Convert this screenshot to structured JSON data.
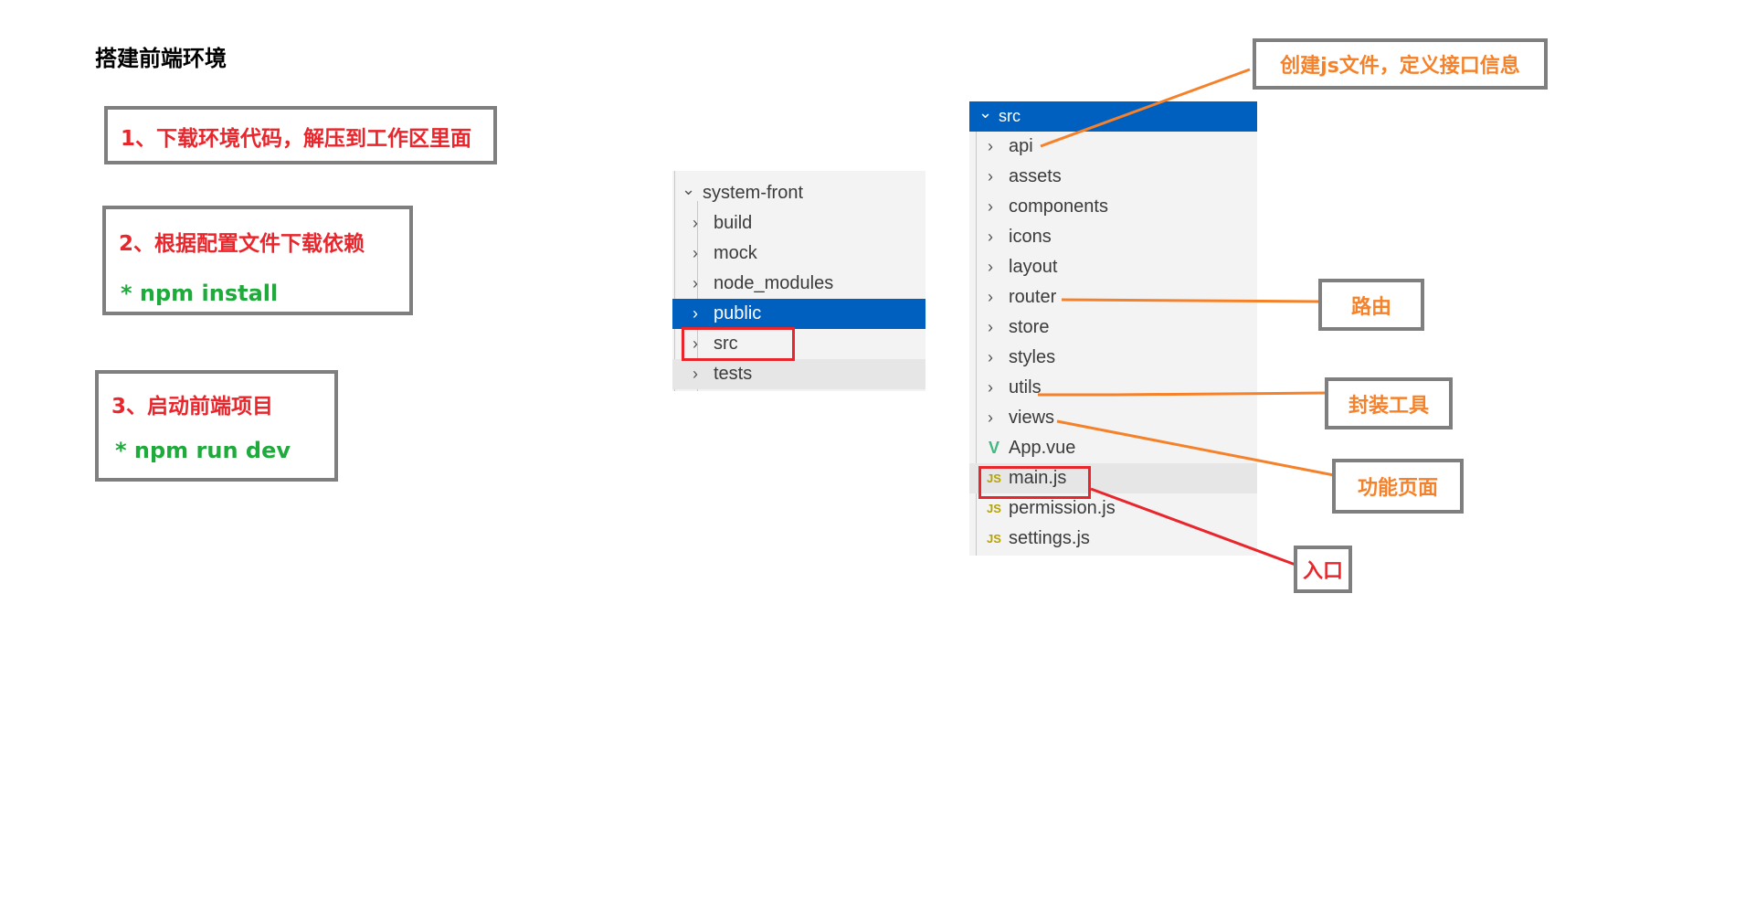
{
  "page_title": "搭建前端环境",
  "steps": [
    {
      "title": "1、下载环境代码，解压到工作区里面"
    },
    {
      "title": "2、根据配置文件下载依赖",
      "command": "* npm install"
    },
    {
      "title": "3、启动前端项目",
      "command": "* npm run dev"
    }
  ],
  "project_tree": {
    "root": "system-front",
    "items": [
      "build",
      "mock",
      "node_modules",
      "public",
      "src",
      "tests"
    ],
    "selected": "public",
    "highlighted": "src"
  },
  "src_tree": {
    "root": "src",
    "folders": [
      "api",
      "assets",
      "components",
      "icons",
      "layout",
      "router",
      "store",
      "styles",
      "utils",
      "views"
    ],
    "files": [
      {
        "name": "App.vue",
        "type": "vue"
      },
      {
        "name": "main.js",
        "type": "js"
      },
      {
        "name": "permission.js",
        "type": "js"
      },
      {
        "name": "settings.js",
        "type": "js"
      }
    ],
    "highlighted": "main.js"
  },
  "icons": {
    "js_badge": "JS",
    "vue_badge": "V",
    "chevron_right": "›",
    "chevron_down": "⌄"
  },
  "annotations": {
    "api": "创建js文件，定义接口信息",
    "router": "路由",
    "utils": "封装工具",
    "views": "功能页面",
    "main": "入口"
  },
  "colors": {
    "step_red": "#e8262c",
    "step_green": "#1faa3c",
    "annotation_orange": "#f5822a",
    "selection_blue": "#0060c0",
    "box_gray": "#7f7f7f"
  }
}
